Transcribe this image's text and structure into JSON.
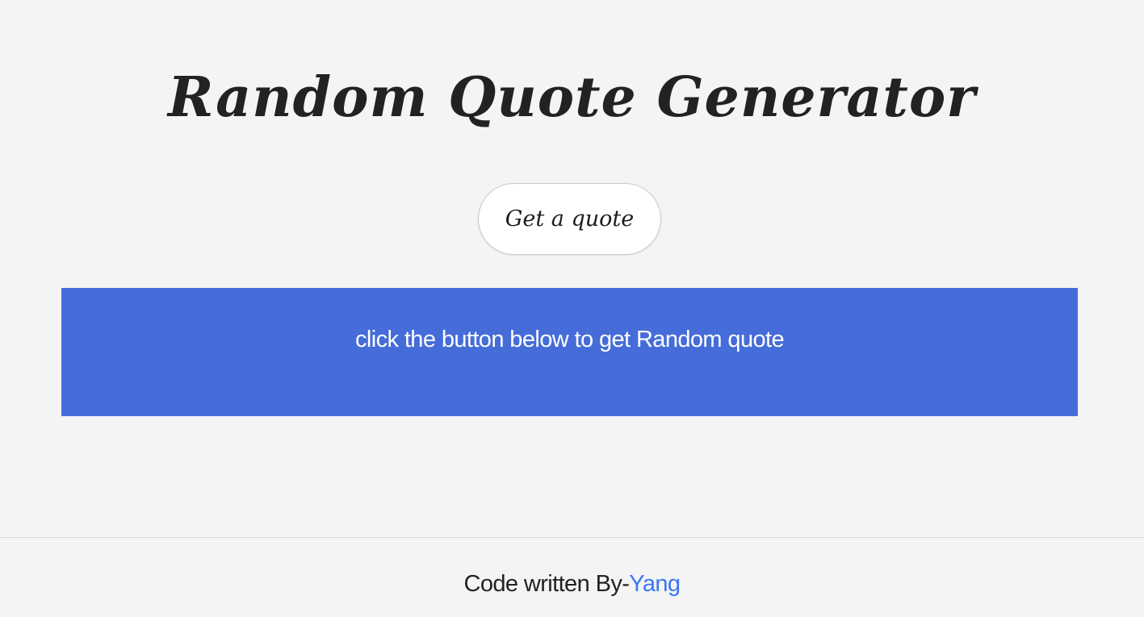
{
  "header": {
    "title": "Random Quote Generator"
  },
  "actions": {
    "get_quote_label": "Get a quote"
  },
  "quote_box": {
    "text": "click the button below to get Random quote",
    "background_color": "#456cd9"
  },
  "footer": {
    "prefix": "Code written By-",
    "author": "Yang",
    "author_link_color": "#3a78f2"
  }
}
